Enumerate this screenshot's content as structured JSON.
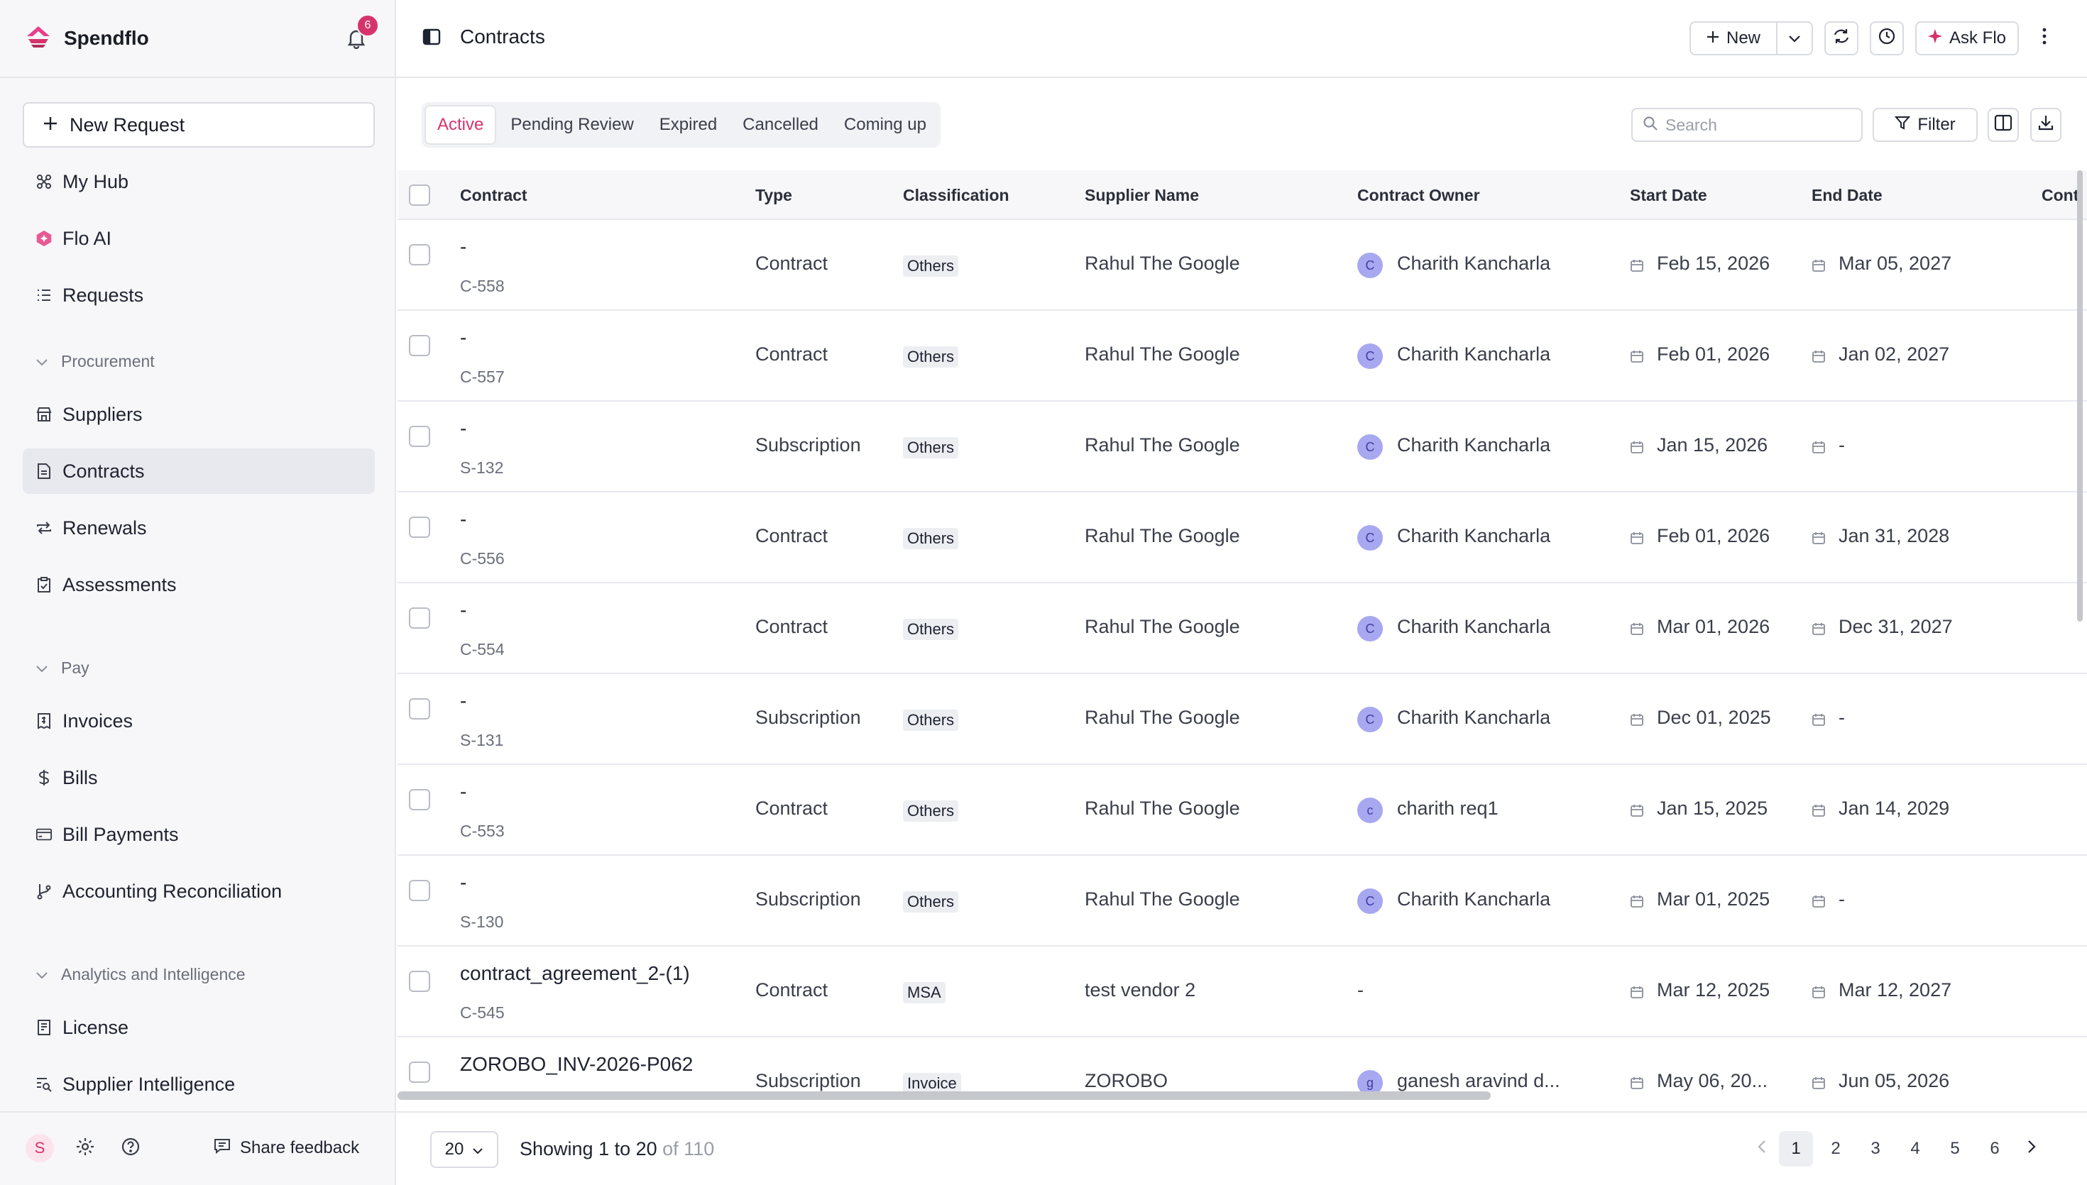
{
  "app": {
    "name": "Spendflo",
    "notification_count": "6"
  },
  "sidebar": {
    "new_request": "New Request",
    "top_items": [
      {
        "label": "My Hub",
        "icon": "hub-icon"
      },
      {
        "label": "Flo AI",
        "icon": "flo-ai-icon"
      },
      {
        "label": "Requests",
        "icon": "list-icon"
      }
    ],
    "sections": [
      {
        "title": "Procurement",
        "items": [
          {
            "label": "Suppliers",
            "icon": "store-icon"
          },
          {
            "label": "Contracts",
            "icon": "document-icon",
            "active": true
          },
          {
            "label": "Renewals",
            "icon": "repeat-icon"
          },
          {
            "label": "Assessments",
            "icon": "clipboard-icon"
          }
        ]
      },
      {
        "title": "Pay",
        "items": [
          {
            "label": "Invoices",
            "icon": "receipt-icon"
          },
          {
            "label": "Bills",
            "icon": "dollar-icon"
          },
          {
            "label": "Bill Payments",
            "icon": "card-icon"
          },
          {
            "label": "Accounting Reconciliation",
            "icon": "git-branch-icon"
          }
        ]
      },
      {
        "title": "Analytics and Intelligence",
        "items": [
          {
            "label": "License",
            "icon": "license-icon"
          },
          {
            "label": "Supplier Intelligence",
            "icon": "search-list-icon"
          }
        ]
      }
    ],
    "footer": {
      "avatar": "S",
      "share_feedback": "Share feedback"
    }
  },
  "header": {
    "title": "Contracts",
    "new_label": "New",
    "ask_flo": "Ask Flo"
  },
  "tabs": [
    "Active",
    "Pending Review",
    "Expired",
    "Cancelled",
    "Coming up"
  ],
  "active_tab": "Active",
  "toolbar": {
    "search_placeholder": "Search",
    "filter_label": "Filter"
  },
  "table": {
    "columns": [
      "Contract",
      "Type",
      "Classification",
      "Supplier Name",
      "Contract Owner",
      "Start Date",
      "End Date",
      "Cont"
    ],
    "rows": [
      {
        "name": "-",
        "id": "C-558",
        "type": "Contract",
        "classification": "Others",
        "supplier": "Rahul The Google",
        "owner_initial": "C",
        "owner": "Charith Kancharla",
        "start": "Feb 15, 2026",
        "end": "Mar 05, 2027"
      },
      {
        "name": "-",
        "id": "C-557",
        "type": "Contract",
        "classification": "Others",
        "supplier": "Rahul The Google",
        "owner_initial": "C",
        "owner": "Charith Kancharla",
        "start": "Feb 01, 2026",
        "end": "Jan 02, 2027"
      },
      {
        "name": "-",
        "id": "S-132",
        "type": "Subscription",
        "classification": "Others",
        "supplier": "Rahul The Google",
        "owner_initial": "C",
        "owner": "Charith Kancharla",
        "start": "Jan 15, 2026",
        "end": "-"
      },
      {
        "name": "-",
        "id": "C-556",
        "type": "Contract",
        "classification": "Others",
        "supplier": "Rahul The Google",
        "owner_initial": "C",
        "owner": "Charith Kancharla",
        "start": "Feb 01, 2026",
        "end": "Jan 31, 2028"
      },
      {
        "name": "-",
        "id": "C-554",
        "type": "Contract",
        "classification": "Others",
        "supplier": "Rahul The Google",
        "owner_initial": "C",
        "owner": "Charith Kancharla",
        "start": "Mar 01, 2026",
        "end": "Dec 31, 2027"
      },
      {
        "name": "-",
        "id": "S-131",
        "type": "Subscription",
        "classification": "Others",
        "supplier": "Rahul The Google",
        "owner_initial": "C",
        "owner": "Charith Kancharla",
        "start": "Dec 01, 2025",
        "end": "-"
      },
      {
        "name": "-",
        "id": "C-553",
        "type": "Contract",
        "classification": "Others",
        "supplier": "Rahul The Google",
        "owner_initial": "c",
        "owner": "charith req1",
        "start": "Jan 15, 2025",
        "end": "Jan 14, 2029"
      },
      {
        "name": "-",
        "id": "S-130",
        "type": "Subscription",
        "classification": "Others",
        "supplier": "Rahul The Google",
        "owner_initial": "C",
        "owner": "Charith Kancharla",
        "start": "Mar 01, 2025",
        "end": "-"
      },
      {
        "name": "contract_agreement_2-(1)",
        "id": "C-545",
        "type": "Contract",
        "classification": "MSA",
        "supplier": "test vendor 2",
        "owner_initial": "",
        "owner": "-",
        "start": "Mar 12, 2025",
        "end": "Mar 12, 2027"
      },
      {
        "name": "ZOROBO_INV-2026-P062",
        "id": "",
        "type": "Subscription",
        "classification": "Invoice",
        "supplier": "ZOROBO",
        "owner_initial": "g",
        "owner": "ganesh aravind d...",
        "start": "May 06, 20...",
        "end": "Jun 05, 2026"
      }
    ]
  },
  "pagination": {
    "page_size": "20",
    "showing": "Showing 1 to 20",
    "total": "of 110",
    "pages": [
      "1",
      "2",
      "3",
      "4",
      "5",
      "6"
    ],
    "current": "1"
  },
  "colors": {
    "accent": "#d6336c",
    "avatar": "#a7a8f0"
  }
}
